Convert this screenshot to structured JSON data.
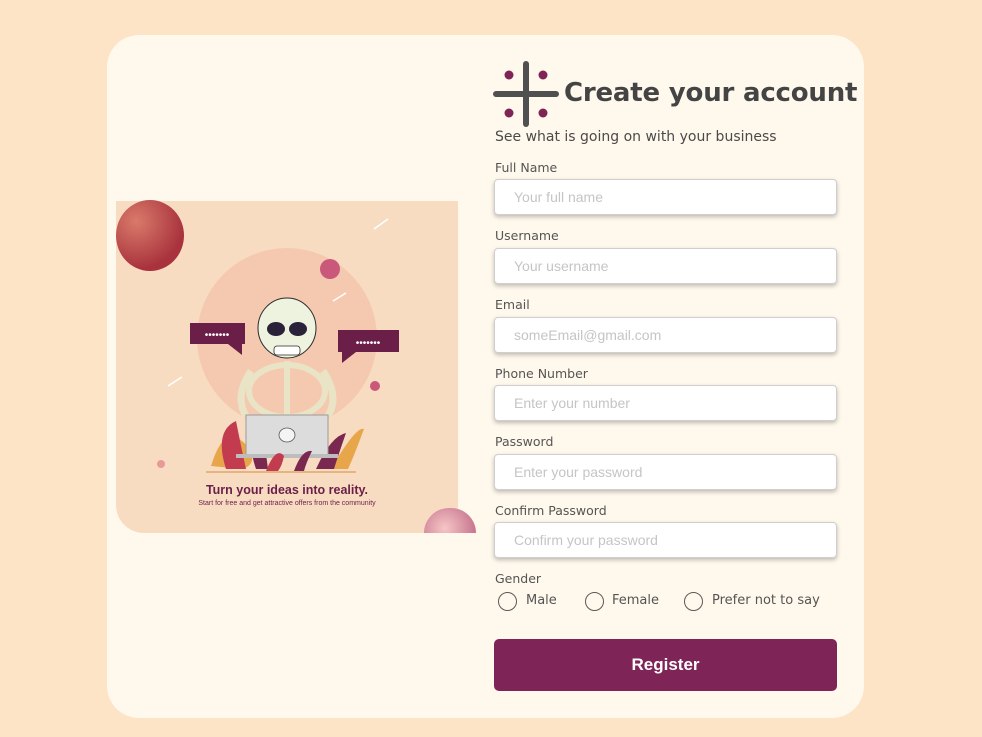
{
  "colors": {
    "page_background": "#fde4c6",
    "card_background": "#fff8ec",
    "accent": "#7e2456",
    "title_text": "#444444"
  },
  "illustration": {
    "title": "Turn your ideas into reality.",
    "subtitle": "Start for free and get attractive offers from the community",
    "icons": [
      "skeleton-icon",
      "laptop-icon",
      "chat-bubble-icon",
      "planet-icon"
    ]
  },
  "header": {
    "logo_icon": "logo-icon",
    "title": "Create your account",
    "subtitle": "See what is going on with your business"
  },
  "form": {
    "full_name": {
      "label": "Full Name",
      "placeholder": "Your full name"
    },
    "username": {
      "label": "Username",
      "placeholder": "Your username"
    },
    "email": {
      "label": "Email",
      "placeholder": "someEmail@gmail.com"
    },
    "phone": {
      "label": "Phone Number",
      "placeholder": "Enter your number"
    },
    "password": {
      "label": "Password",
      "placeholder": "Enter your password"
    },
    "confirm_password": {
      "label": "Confirm Password",
      "placeholder": "Confirm your password"
    },
    "gender": {
      "label": "Gender",
      "options": [
        "Male",
        "Female",
        "Prefer not to say"
      ]
    },
    "register_label": "Register"
  }
}
